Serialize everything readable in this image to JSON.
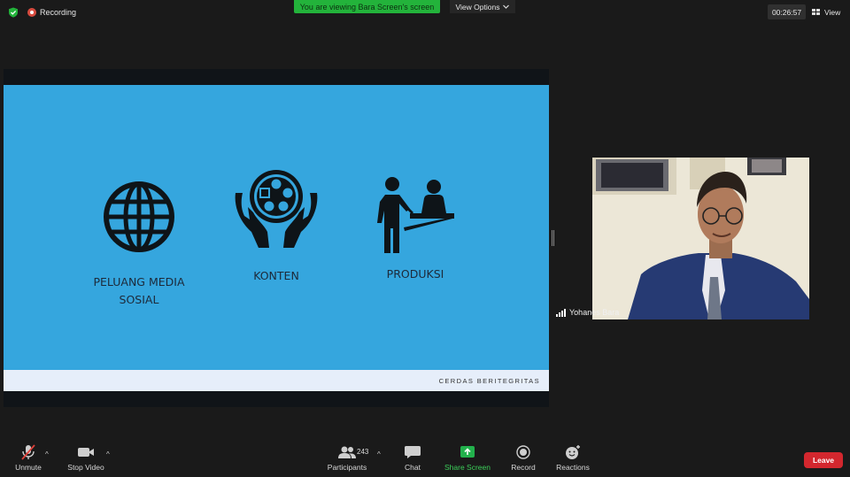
{
  "top_bar": {
    "recording_label": "Recording",
    "viewing_banner": "You are viewing Bara Screen's screen",
    "view_options_label": "View Options",
    "timer": "00:26:57",
    "view_label": "View"
  },
  "slide": {
    "features": [
      {
        "label_line1": "PELUANG MEDIA",
        "label_line2": "SOSIAL",
        "icon": "globe-icon"
      },
      {
        "label_line1": "KONTEN",
        "label_line2": "",
        "icon": "hands-film-reel-icon"
      },
      {
        "label_line1": "PRODUKSI",
        "label_line2": "",
        "icon": "consultation-icon"
      }
    ],
    "footer_text": "CERDAS BERITEGRITAS"
  },
  "participant": {
    "name": "Yohanes Bara"
  },
  "toolbar": {
    "unmute": "Unmute",
    "stop_video": "Stop Video",
    "participants": "Participants",
    "participant_count": "243",
    "chat": "Chat",
    "share_screen": "Share Screen",
    "record": "Record",
    "reactions": "Reactions",
    "leave": "Leave"
  },
  "colors": {
    "slide_background": "#35a6de",
    "slide_footer": "#e6eefa",
    "banner_green": "#23b33b",
    "leave_red": "#d3272e",
    "share_green": "#22b14c"
  }
}
